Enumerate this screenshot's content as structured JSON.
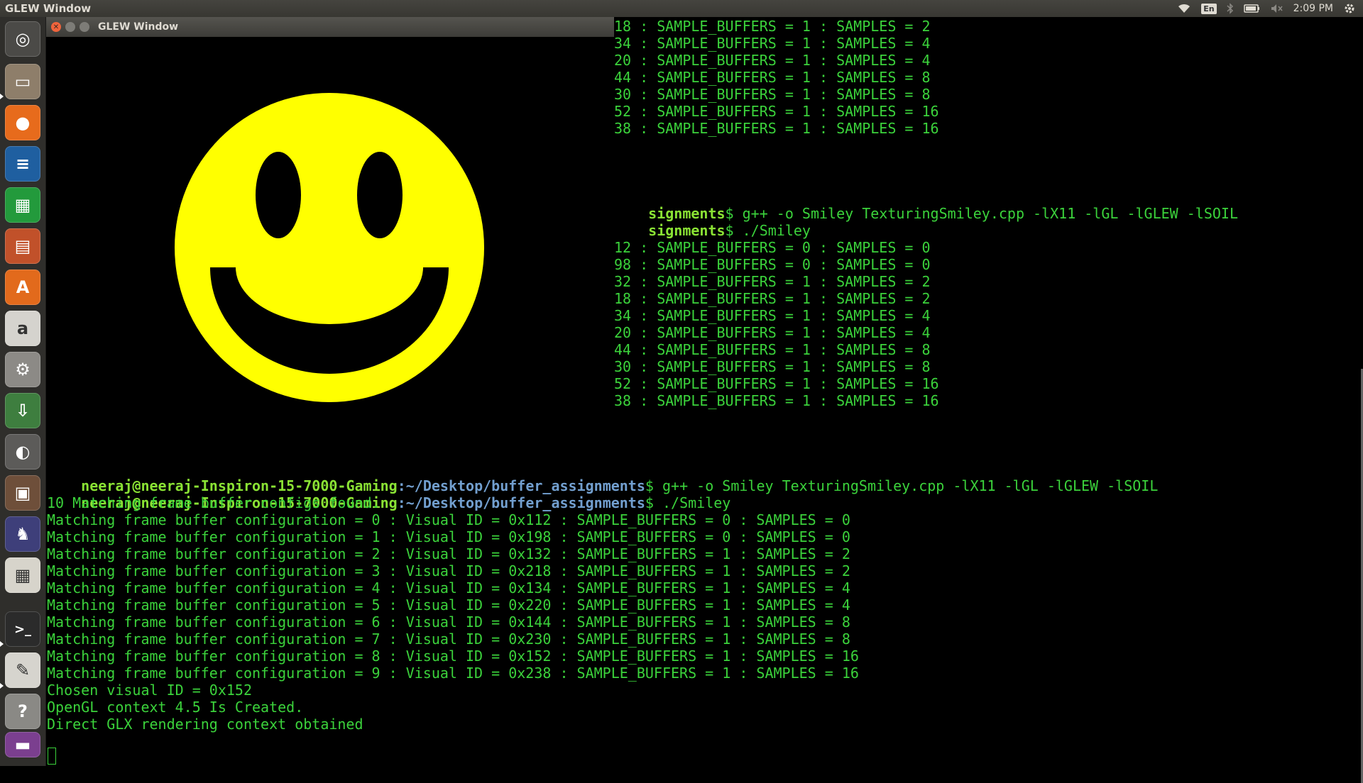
{
  "top_panel": {
    "title": "GLEW Window",
    "language": "En",
    "clock": "2:09 PM"
  },
  "launcher": {
    "items": [
      {
        "name": "ubuntu-dash",
        "glyph": "◎",
        "bg": "#4b4a47"
      },
      {
        "name": "files",
        "glyph": "▭",
        "bg": "#8e7e6a"
      },
      {
        "name": "firefox",
        "glyph": "●",
        "bg": "#e76b1c"
      },
      {
        "name": "libreoffice-writer",
        "glyph": "≡",
        "bg": "#1f5fa0"
      },
      {
        "name": "libreoffice-calc",
        "glyph": "▦",
        "bg": "#239a3c"
      },
      {
        "name": "libreoffice-impress",
        "glyph": "▤",
        "bg": "#c1512a"
      },
      {
        "name": "software-center",
        "glyph": "A",
        "bg": "#e26a1c"
      },
      {
        "name": "amazon",
        "glyph": "a",
        "bg": "#d5d3ce"
      },
      {
        "name": "system-settings",
        "glyph": "⚙",
        "bg": "#8c8a86"
      },
      {
        "name": "installer",
        "glyph": "⇩",
        "bg": "#3e7e3f"
      },
      {
        "name": "unknown-app",
        "glyph": "◐",
        "bg": "#5c5b59"
      },
      {
        "name": "backup",
        "glyph": "▣",
        "bg": "#6e4f3a"
      },
      {
        "name": "chess",
        "glyph": "♞",
        "bg": "#3e3f7a"
      },
      {
        "name": "sudoku",
        "glyph": "▦",
        "bg": "#d7d4cb"
      },
      {
        "name": "terminal",
        "glyph": ">_",
        "bg": "#2b2b2b"
      },
      {
        "name": "text-editor",
        "glyph": "✎",
        "bg": "#d6d4ce"
      },
      {
        "name": "help",
        "glyph": "?",
        "bg": "#8a8985"
      },
      {
        "name": "workspace-switcher",
        "glyph": "▬",
        "bg": "#7b3f8f"
      }
    ]
  },
  "glew_window": {
    "title": "GLEW Window",
    "colors": {
      "face": "#ffff00",
      "features": "#000000"
    }
  },
  "terminal": {
    "top_right_lines": [
      "18 : SAMPLE_BUFFERS = 1 : SAMPLES = 2",
      "34 : SAMPLE_BUFFERS = 1 : SAMPLES = 4",
      "20 : SAMPLE_BUFFERS = 1 : SAMPLES = 4",
      "44 : SAMPLE_BUFFERS = 1 : SAMPLES = 8",
      "30 : SAMPLE_BUFFERS = 1 : SAMPLES = 8",
      "52 : SAMPLE_BUFFERS = 1 : SAMPLES = 16",
      "38 : SAMPLE_BUFFERS = 1 : SAMPLES = 16"
    ],
    "mid_prompt_tail": "signments",
    "mid_cmd_1": "$ g++ -o Smiley TexturingSmiley.cpp -lX11 -lGL -lGLEW -lSOIL",
    "mid_cmd_2": "$ ./Smiley",
    "mid_right_lines": [
      "12 : SAMPLE_BUFFERS = 0 : SAMPLES = 0",
      "98 : SAMPLE_BUFFERS = 0 : SAMPLES = 0",
      "32 : SAMPLE_BUFFERS = 1 : SAMPLES = 2",
      "18 : SAMPLE_BUFFERS = 1 : SAMPLES = 2",
      "34 : SAMPLE_BUFFERS = 1 : SAMPLES = 4",
      "20 : SAMPLE_BUFFERS = 1 : SAMPLES = 4",
      "44 : SAMPLE_BUFFERS = 1 : SAMPLES = 8",
      "30 : SAMPLE_BUFFERS = 1 : SAMPLES = 8",
      "52 : SAMPLE_BUFFERS = 1 : SAMPLES = 16",
      "38 : SAMPLE_BUFFERS = 1 : SAMPLES = 16"
    ],
    "prompt_user": "neeraj@neeraj-Inspiron-15-7000-Gaming",
    "prompt_path": ":~/Desktop/buffer_assignments",
    "cmd_1": "$ g++ -o Smiley TexturingSmiley.cpp -lX11 -lGL -lGLEW -lSOIL",
    "cmd_2": "$ ./Smiley",
    "output_lines": [
      "10 Matching frame buffer configs found.",
      "Matching frame buffer configuration = 0 : Visual ID = 0x112 : SAMPLE_BUFFERS = 0 : SAMPLES = 0",
      "Matching frame buffer configuration = 1 : Visual ID = 0x198 : SAMPLE_BUFFERS = 0 : SAMPLES = 0",
      "Matching frame buffer configuration = 2 : Visual ID = 0x132 : SAMPLE_BUFFERS = 1 : SAMPLES = 2",
      "Matching frame buffer configuration = 3 : Visual ID = 0x218 : SAMPLE_BUFFERS = 1 : SAMPLES = 2",
      "Matching frame buffer configuration = 4 : Visual ID = 0x134 : SAMPLE_BUFFERS = 1 : SAMPLES = 4",
      "Matching frame buffer configuration = 5 : Visual ID = 0x220 : SAMPLE_BUFFERS = 1 : SAMPLES = 4",
      "Matching frame buffer configuration = 6 : Visual ID = 0x144 : SAMPLE_BUFFERS = 1 : SAMPLES = 8",
      "Matching frame buffer configuration = 7 : Visual ID = 0x230 : SAMPLE_BUFFERS = 1 : SAMPLES = 8",
      "Matching frame buffer configuration = 8 : Visual ID = 0x152 : SAMPLE_BUFFERS = 1 : SAMPLES = 16",
      "Matching frame buffer configuration = 9 : Visual ID = 0x238 : SAMPLE_BUFFERS = 1 : SAMPLES = 16",
      "Chosen visual ID = 0x152",
      "OpenGL context 4.5 Is Created.",
      "Direct GLX rendering context obtained"
    ]
  }
}
